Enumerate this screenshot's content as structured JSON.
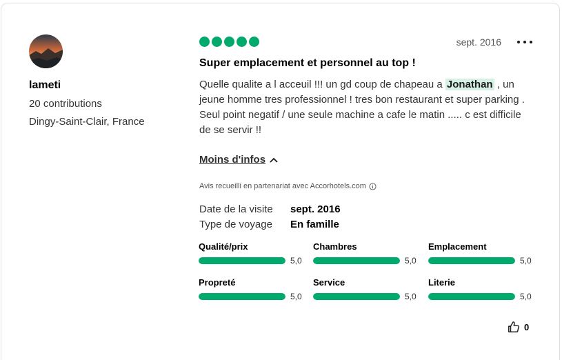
{
  "reviewer": {
    "name": "lameti",
    "contributions": "20 contributions",
    "location": "Dingy-Saint-Clair, France"
  },
  "review": {
    "bubble_rating": 5,
    "date": "sept. 2016",
    "title": "Super emplacement et personnel au top !",
    "body": {
      "p1_before": "Quelle qualite a l acceuil !!! un gd coup de chapeau a ",
      "p1_highlight": "Jonathan",
      "p1_after": " , un jeune homme tres professionnel ! tres bon restaurant et super parking .",
      "p2": "Seul point negatif / une seule machine  a cafe le matin ..... c est difficile de se servir !!"
    },
    "less_info_label": "Moins d'infos",
    "partner_note": "Avis recueilli en partenariat avec Accorhotels.com",
    "visit_date_label": "Date de la visite",
    "visit_date_value": "sept. 2016",
    "trip_type_label": "Type de voyage",
    "trip_type_value": "En famille",
    "helpful_count": "0"
  },
  "ratings": [
    {
      "label": "Qualité/prix",
      "value": "5,0",
      "fraction": 1.0
    },
    {
      "label": "Chambres",
      "value": "5,0",
      "fraction": 1.0
    },
    {
      "label": "Emplacement",
      "value": "5,0",
      "fraction": 1.0
    },
    {
      "label": "Propreté",
      "value": "5,0",
      "fraction": 1.0
    },
    {
      "label": "Service",
      "value": "5,0",
      "fraction": 1.0
    },
    {
      "label": "Literie",
      "value": "5,0",
      "fraction": 1.0
    }
  ],
  "colors": {
    "accent_green": "#00aa6c",
    "highlight_bg": "#d6f0e4"
  },
  "icons": {
    "more": "more-dots-icon",
    "chevron": "chevron-up-icon",
    "info": "info-icon",
    "thumb": "thumbs-up-icon"
  }
}
